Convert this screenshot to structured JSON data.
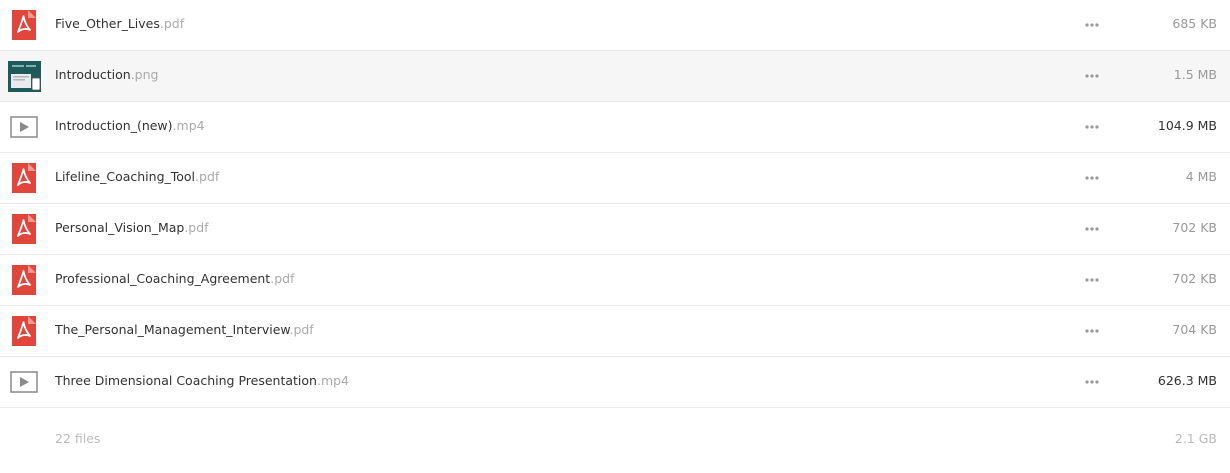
{
  "files": [
    {
      "base": "Five_Other_Lives",
      "ext": ".pdf",
      "size": "685 KB",
      "icon": "pdf-icon",
      "more": "more-options-icon"
    },
    {
      "base": "Introduction",
      "ext": ".png",
      "size": "1.5 MB",
      "icon": "image-thumbnail-icon",
      "more": "more-options-icon"
    },
    {
      "base": "Introduction_(new)",
      "ext": ".mp4",
      "size": "104.9 MB",
      "icon": "video-play-icon",
      "more": "more-options-icon"
    },
    {
      "base": "Lifeline_Coaching_Tool",
      "ext": ".pdf",
      "size": "4 MB",
      "icon": "pdf-icon",
      "more": "more-options-icon"
    },
    {
      "base": "Personal_Vision_Map",
      "ext": ".pdf",
      "size": "702 KB",
      "icon": "pdf-icon",
      "more": "more-options-icon"
    },
    {
      "base": "Professional_Coaching_Agreement",
      "ext": ".pdf",
      "size": "702 KB",
      "icon": "pdf-icon",
      "more": "more-options-icon"
    },
    {
      "base": "The_Personal_Management_Interview",
      "ext": ".pdf",
      "size": "704 KB",
      "icon": "pdf-icon",
      "more": "more-options-icon"
    },
    {
      "base": "Three Dimensional Coaching Presentation",
      "ext": ".mp4",
      "size": "626.3 MB",
      "icon": "video-play-icon",
      "more": "more-options-icon"
    }
  ],
  "footer": {
    "count": "22 files",
    "total": "2.1 GB"
  },
  "colors": {
    "pdf_red": "#e0463c",
    "video_gray": "#8a8a8a",
    "thumb_teal": "#1f5a5a"
  }
}
